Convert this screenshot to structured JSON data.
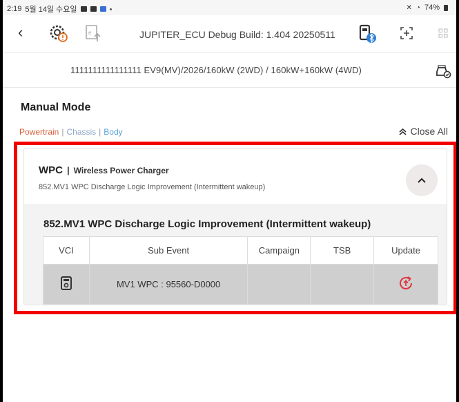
{
  "statusbar": {
    "time": "2:19",
    "date": "5월 14일 수요일",
    "battery": "74%"
  },
  "appbar": {
    "back_icon": "chevron-left-icon",
    "title": "JUPITER_ECU Debug Build: 1.404 20250511"
  },
  "vehicle": {
    "description": "1111111111111111  EV9(MV)/2026/160kW (2WD) / 160kW+160kW (4WD)"
  },
  "page": {
    "mode_title": "Manual Mode",
    "categories": {
      "powertrain": "Powertrain",
      "chassis": "Chassis",
      "body": "Body",
      "separator": "|"
    },
    "close_all": "Close All"
  },
  "card": {
    "code": "WPC",
    "separator": "|",
    "full_name": "Wireless Power Charger",
    "subtitle": "852.MV1 WPC Discharge Logic Improvement (Intermittent wakeup)",
    "event_title": "852.MV1 WPC Discharge Logic Improvement (Intermittent wakeup)",
    "table": {
      "headers": [
        "VCI",
        "Sub Event",
        "Campaign",
        "TSB",
        "Update"
      ],
      "rows": [
        {
          "vci_icon": "vci-device-icon",
          "sub_event": "MV1 WPC : 95560-D0000",
          "campaign": "",
          "tsb": "",
          "update_icon": "update-icon"
        }
      ]
    }
  },
  "colors": {
    "highlight": "#f20000",
    "powertrain": "#d9603a",
    "chassis": "#8ea6c8",
    "body": "#5aa3d8",
    "update_icon": "#e0343e"
  }
}
